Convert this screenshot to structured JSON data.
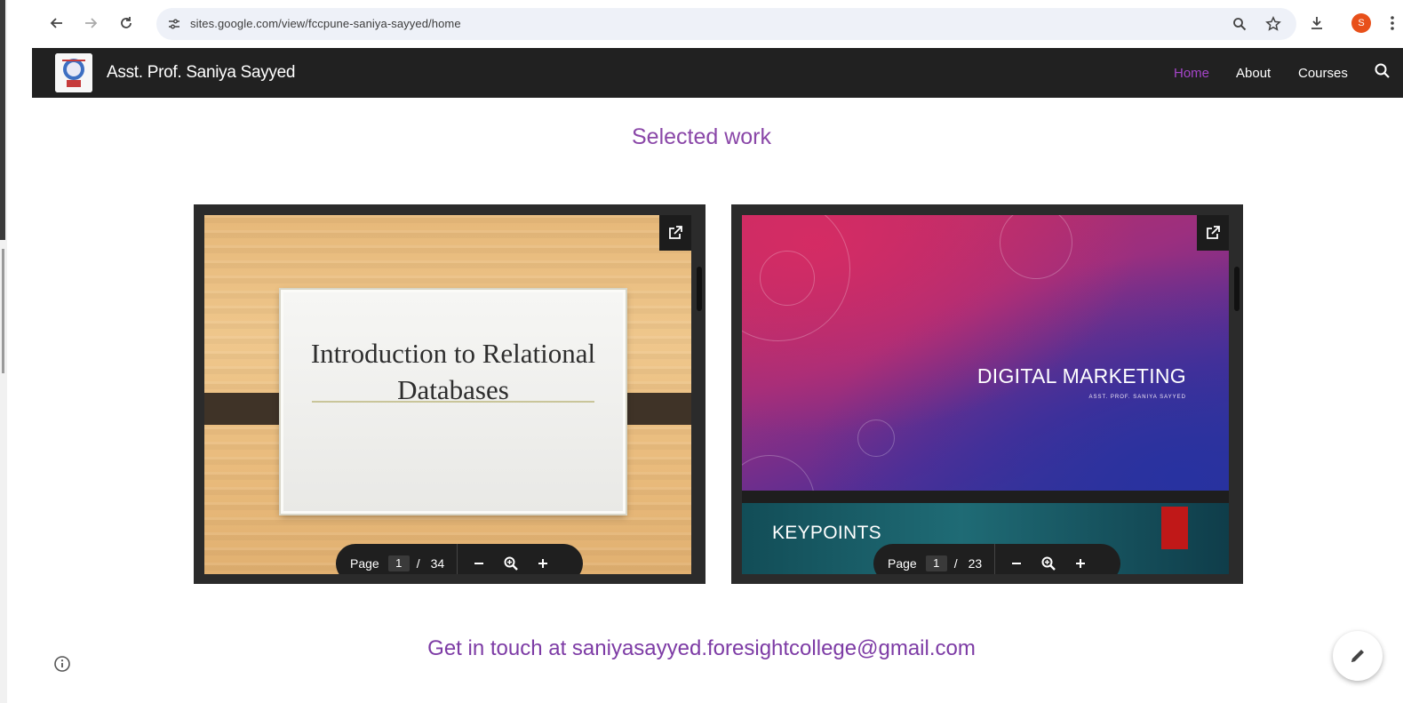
{
  "browser": {
    "url": "sites.google.com/view/fccpune-saniya-sayyed/home",
    "profile_initial": "S"
  },
  "site": {
    "title": "Asst. Prof. Saniya Sayyed",
    "nav": [
      {
        "label": "Home",
        "active": true
      },
      {
        "label": "About",
        "active": false
      },
      {
        "label": "Courses",
        "active": false
      }
    ]
  },
  "section_title": "Selected work",
  "cards": [
    {
      "slide_title": "Introduction to Relational Databases",
      "page_label": "Page",
      "page_current": "1",
      "page_sep": "/",
      "page_total": "34"
    },
    {
      "slide_title": "DIGITAL MARKETING",
      "slide_subtitle": "ASST. PROF. SANIYA SAYYED",
      "next_slide_title": "KEYPOINTS",
      "page_label": "Page",
      "page_current": "1",
      "page_sep": "/",
      "page_total": "23"
    }
  ],
  "contact": "Get in touch at saniyasayyed.foresightcollege@gmail.com",
  "colors": {
    "accent": "#8a47a8",
    "nav_active": "#a545c9",
    "header_bg": "#212121"
  }
}
